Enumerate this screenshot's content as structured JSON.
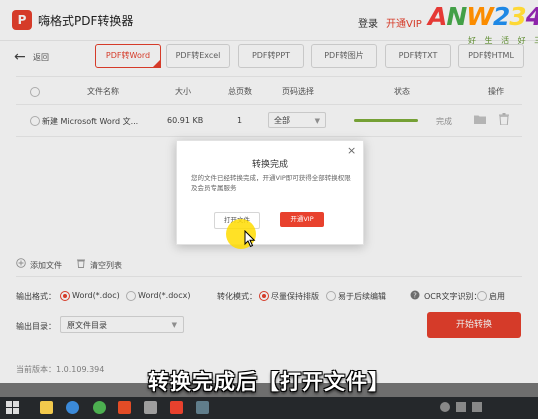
{
  "app": {
    "logo_glyph": "P",
    "title": "嗨格式PDF转换器",
    "login": "登录",
    "vip": "开通VIP",
    "brand_color": "#e8412d"
  },
  "watermark": {
    "text": "ANW234",
    "sub": "好 生 活 好 三 言"
  },
  "nav": {
    "back_icon": "←",
    "back_label": "返回"
  },
  "tabs": [
    {
      "label": "PDF转Word",
      "active": true
    },
    {
      "label": "PDF转Excel",
      "active": false
    },
    {
      "label": "PDF转PPT",
      "active": false
    },
    {
      "label": "PDF转图片",
      "active": false
    },
    {
      "label": "PDF转TXT",
      "active": false
    },
    {
      "label": "PDF转HTML",
      "active": false
    }
  ],
  "table": {
    "headers": {
      "filename": "文件名称",
      "size": "大小",
      "pages": "总页数",
      "page_select": "页码选择",
      "status": "状态",
      "actions": "操作"
    },
    "rows": [
      {
        "filename": "新建 Microsoft Word 文...",
        "size": "60.91 KB",
        "pages": "1",
        "page_select": "全部",
        "progress": 1.0,
        "status": "完成"
      }
    ]
  },
  "links": {
    "add_file": "添加文件",
    "clear_list": "清空列表"
  },
  "options": {
    "format_label": "输出格式：",
    "format_doc": "Word(*.doc)",
    "format_docx": "Word(*.docx)",
    "mode_label": "转化模式：",
    "mode_keep": "尽量保持排版",
    "mode_edit": "易于后续编辑",
    "ocr_label": "OCR文字识别：",
    "ocr_enable": "启用",
    "dir_label": "输出目录：",
    "dir_value": "原文件目录"
  },
  "start_button": "开始转换",
  "version": "当前版本：1.0.109.394",
  "dialog": {
    "title": "转换完成",
    "close": "×",
    "message": "您的文件已经转换完成，开通VIP即可获得全部转换权限及会员专属服务",
    "open_button": "打开文件",
    "vip_button": "开通VIP"
  },
  "caption": "转换完成后【打开文件】"
}
